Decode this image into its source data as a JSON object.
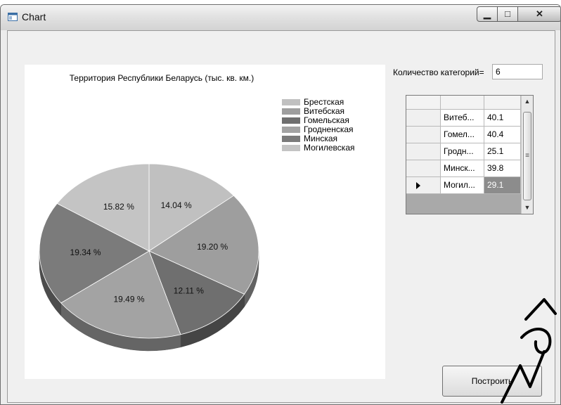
{
  "window": {
    "title": "Chart"
  },
  "chart_data": {
    "type": "pie",
    "title": "Территория Республики Беларусь (тыс. кв. км.)",
    "categories": [
      "Брестская",
      "Витебская",
      "Гомельская",
      "Гродненская",
      "Минская",
      "Могилевская"
    ],
    "values": [
      14.04,
      19.2,
      12.11,
      19.49,
      19.34,
      15.82
    ],
    "value_labels": [
      "14.04 %",
      "19.20 %",
      "12.11 %",
      "19.49 %",
      "19.34 %",
      "15.82 %"
    ],
    "colors": [
      "#c0c0c0",
      "#9e9e9e",
      "#6f6f6f",
      "#a3a3a3",
      "#7b7b7b",
      "#c4c4c4"
    ],
    "style": "3d",
    "legend_placement": "top-right",
    "legend": [
      "Брестская",
      "Витебская",
      "Гомельская",
      "Гродненская",
      "Минская",
      "Могилевская"
    ]
  },
  "controls": {
    "category_count_label": "Количество категорий=",
    "category_count_value": "6",
    "build_button_label": "Построить"
  },
  "grid": {
    "rows": [
      {
        "name": "Витеб...",
        "value": "40.1"
      },
      {
        "name": "Гомел...",
        "value": "40.4"
      },
      {
        "name": "Гродн...",
        "value": "25.1"
      },
      {
        "name": "Минск...",
        "value": "39.8"
      },
      {
        "name": "Могил...",
        "value": "29.1"
      }
    ],
    "current_row_index": 4
  }
}
